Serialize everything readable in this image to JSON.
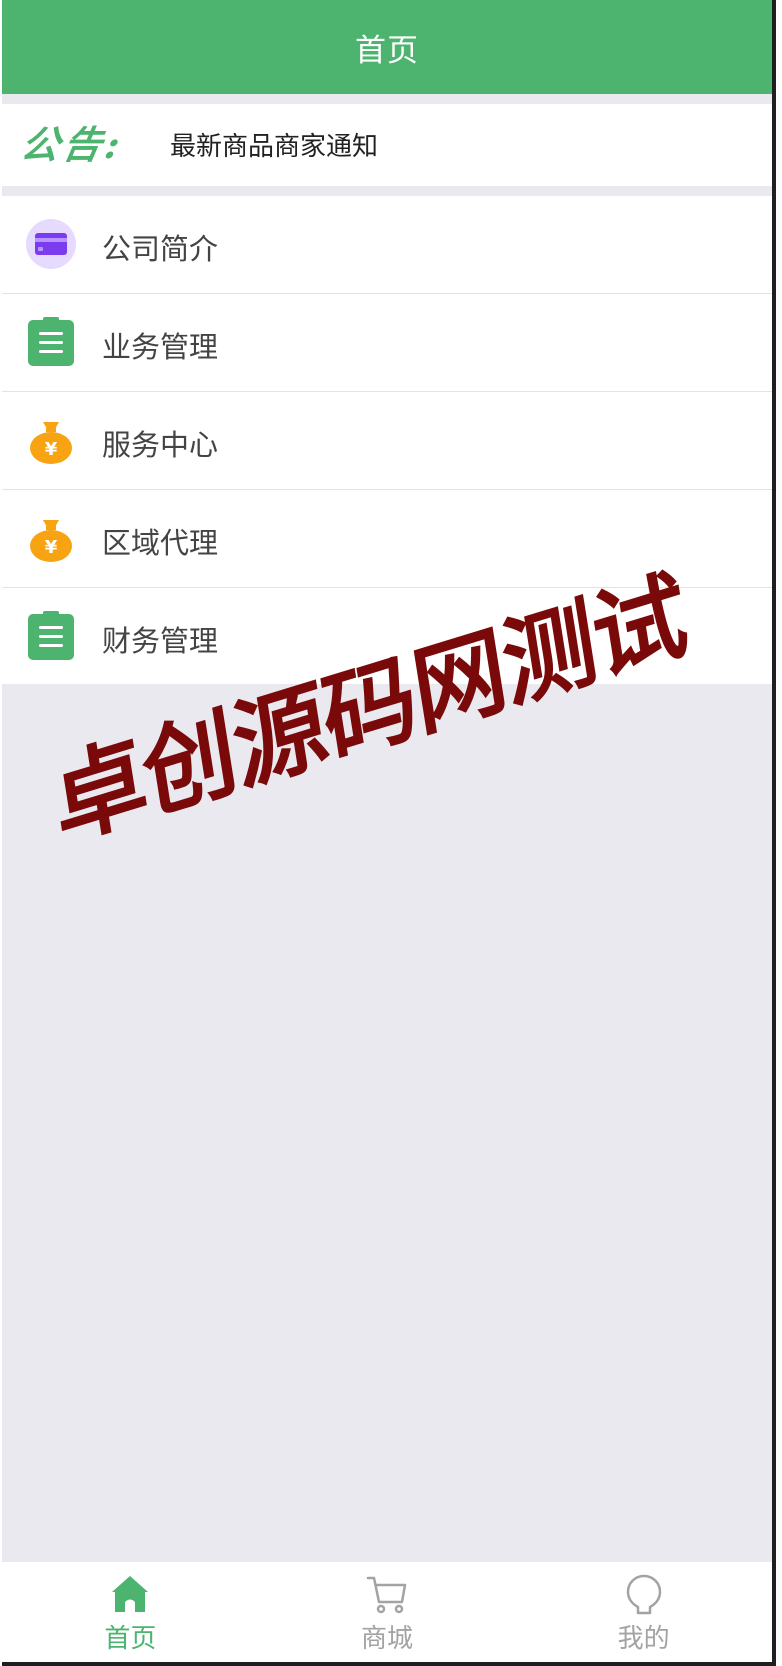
{
  "header": {
    "title": "首页"
  },
  "notice": {
    "logo_text": "公告:",
    "text": "最新商品商家通知"
  },
  "menu": {
    "items": [
      {
        "label": "公司简介",
        "icon": "card-icon"
      },
      {
        "label": "业务管理",
        "icon": "clipboard-list-icon"
      },
      {
        "label": "服务中心",
        "icon": "money-bag-icon"
      },
      {
        "label": "区域代理",
        "icon": "money-bag-icon"
      },
      {
        "label": "财务管理",
        "icon": "clipboard-list-icon"
      }
    ]
  },
  "watermark": {
    "text": "卓创源码网测试"
  },
  "tabbar": {
    "items": [
      {
        "label": "首页",
        "icon": "home-icon",
        "active": true
      },
      {
        "label": "商城",
        "icon": "cart-icon",
        "active": false
      },
      {
        "label": "我的",
        "icon": "user-icon",
        "active": false
      }
    ]
  },
  "colors": {
    "primary": "#4cb46e",
    "background": "#eae9f0",
    "card_purple": "#7b3cf0",
    "bag_orange": "#f8a312",
    "watermark": "#7a0a0a",
    "tab_inactive": "#a3a3a3"
  }
}
